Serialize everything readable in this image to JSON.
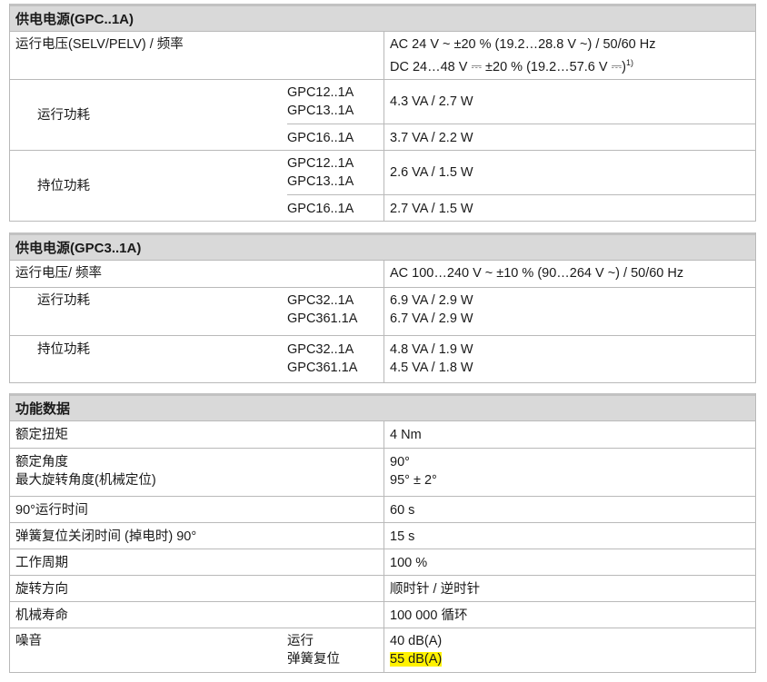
{
  "gpc1": {
    "title": "供电电源(GPC..1A)",
    "voltage_label": "运行电压(SELV/PELV) / 频率",
    "voltage_value_ac": "AC 24 V ~ ±20 % (19.2…28.8 V ~) / 50/60 Hz",
    "voltage_value_dc": "DC 24…48 V ⎓ ±20 % (19.2…57.6 V ⎓)",
    "voltage_footnote": "1)",
    "run_label": "运行功耗",
    "run_models_a": [
      "GPC12..1A",
      "GPC13..1A"
    ],
    "run_value_a": "4.3 VA / 2.7 W",
    "run_model_b": "GPC16..1A",
    "run_value_b": "3.7 VA / 2.2 W",
    "hold_label": "持位功耗",
    "hold_models_a": [
      "GPC12..1A",
      "GPC13..1A"
    ],
    "hold_value_a": "2.6 VA / 1.5 W",
    "hold_model_b": "GPC16..1A",
    "hold_value_b": "2.7 VA / 1.5 W"
  },
  "gpc3": {
    "title": "供电电源(GPC3..1A)",
    "voltage_label": "运行电压/ 频率",
    "voltage_value": "AC 100…240 V ~ ±10 % (90…264 V ~) / 50/60 Hz",
    "run_label": "运行功耗",
    "run_models": [
      "GPC32..1A",
      "GPC361.1A"
    ],
    "run_values": [
      "6.9 VA / 2.9 W",
      "6.7 VA / 2.9 W"
    ],
    "hold_label": "持位功耗",
    "hold_models": [
      "GPC32..1A",
      "GPC361.1A"
    ],
    "hold_values": [
      "4.8 VA / 1.9 W",
      "4.5 VA / 1.8 W"
    ]
  },
  "func": {
    "title": "功能数据",
    "torque_label": "额定扭矩",
    "torque_value": "4 Nm",
    "angle_label": "额定角度",
    "angle_value": "90°",
    "max_angle_label": "最大旋转角度(机械定位)",
    "max_angle_value": "95° ± 2°",
    "runtime_label": "90°运行时间",
    "runtime_value": "60 s",
    "spring_label": "弹簧复位关闭时间 (掉电时) 90°",
    "spring_value": "15 s",
    "duty_label": "工作周期",
    "duty_value": "100 %",
    "direction_label": "旋转方向",
    "direction_value": "顺时针 / 逆时针",
    "life_label": "机械寿命",
    "life_value": "100 000 循环",
    "noise_label": "噪音",
    "noise_run_label": "运行",
    "noise_run_value": "40 dB(A)",
    "noise_spring_label": "弹簧复位",
    "noise_spring_value": "55 dB(A)",
    "highlight_color": "#fff200"
  }
}
